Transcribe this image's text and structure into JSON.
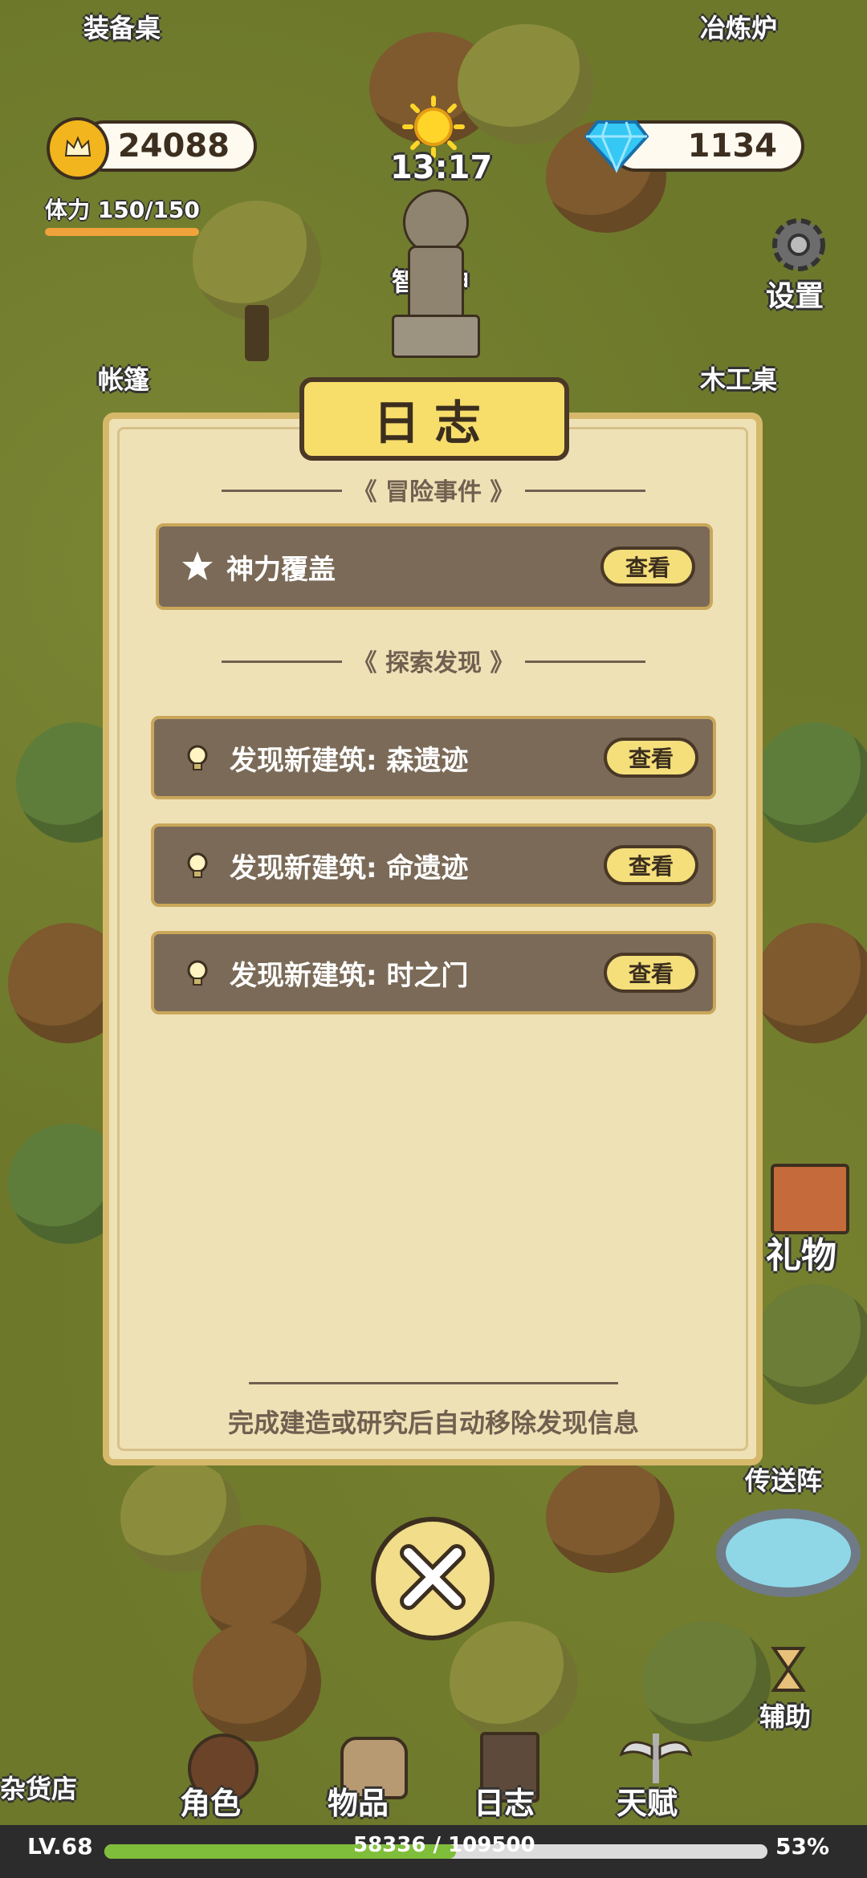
{
  "hud": {
    "coins": "24088",
    "gems": "1134",
    "stamina_label": "体力 150/150",
    "stamina_fraction": 1.0,
    "time": "13:17",
    "settings_label": "设置"
  },
  "map_labels": {
    "equipment_table": "装备桌",
    "smelter": "冶炼炉",
    "wisdom_god": "智慧神",
    "tent": "帐篷",
    "carpentry_table": "木工桌",
    "gift": "礼物",
    "teleport": "传送阵",
    "assist": "辅助",
    "grocery": "杂货店"
  },
  "journal": {
    "title": "日志",
    "adventure_section": "《 冒险事件 》",
    "explore_section": "《 探索发现 》",
    "adventure_events": [
      {
        "label": "神力覆盖",
        "button": "查看"
      }
    ],
    "discoveries": [
      {
        "label": "发现新建筑: 森遗迹",
        "button": "查看"
      },
      {
        "label": "发现新建筑: 命遗迹",
        "button": "查看"
      },
      {
        "label": "发现新建筑: 时之门",
        "button": "查看"
      }
    ],
    "footer": "完成建造或研究后自动移除发现信息"
  },
  "nav": {
    "character": "角色",
    "items": "物品",
    "journal": "日志",
    "talent": "天赋"
  },
  "bottom": {
    "level": "LV.68",
    "xp": "58336 / 109500",
    "percent": "53%",
    "xp_fraction": 0.53
  },
  "colors": {
    "accent_gold": "#f4df7b",
    "panel_bg": "#efe1b6",
    "row_bg": "#7a6a57",
    "xp_green": "#7fbe3a"
  }
}
